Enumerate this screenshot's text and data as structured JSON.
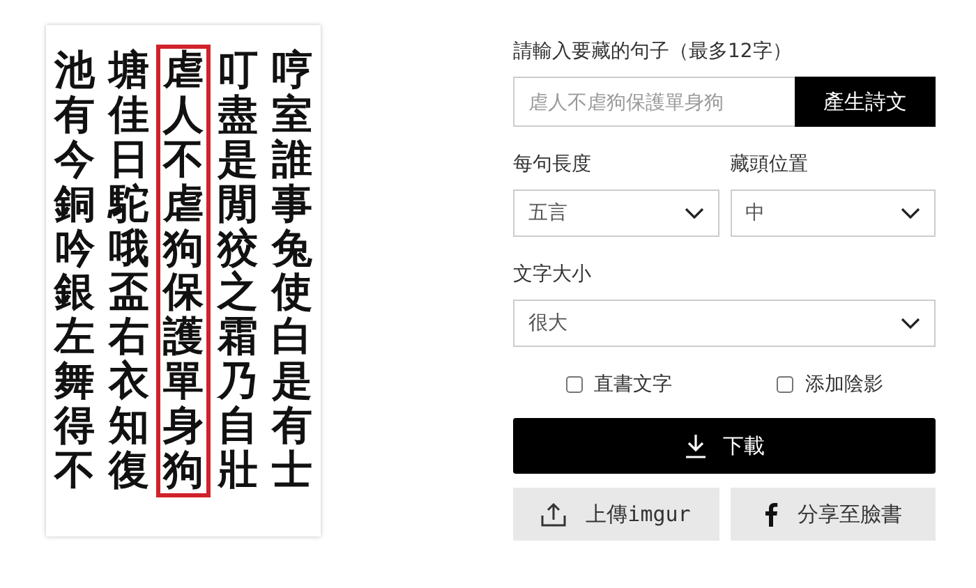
{
  "poem": {
    "columns": [
      {
        "text": "池有今銅吟銀左舞得不",
        "highlighted": false
      },
      {
        "text": "塘佳日駝哦盃右衣知復",
        "highlighted": false
      },
      {
        "text": "虐人不虐狗保護單身狗",
        "highlighted": true
      },
      {
        "text": "叮盡是閒狡之霜乃自壯",
        "highlighted": false
      },
      {
        "text": "哼室誰事兔使白是有士",
        "highlighted": false
      }
    ]
  },
  "form": {
    "sentence_label": "請輸入要藏的句子（最多12字）",
    "sentence": {
      "placeholder": "虐人不虐狗保護單身狗"
    },
    "generate_button": "產生詩文",
    "selects": [
      {
        "label": "每句長度",
        "value": "五言"
      },
      {
        "label": "藏頭位置",
        "value": "中"
      }
    ],
    "size_select": {
      "label": "文字大小",
      "value": "很大"
    },
    "checkboxes": [
      {
        "label": "直書文字",
        "checked": false
      },
      {
        "label": "添加陰影",
        "checked": false
      }
    ],
    "download_button": "下載",
    "share_buttons": [
      {
        "kind": "upload",
        "label": "上傳imgur"
      },
      {
        "kind": "facebook",
        "label": "分享至臉書"
      }
    ]
  }
}
